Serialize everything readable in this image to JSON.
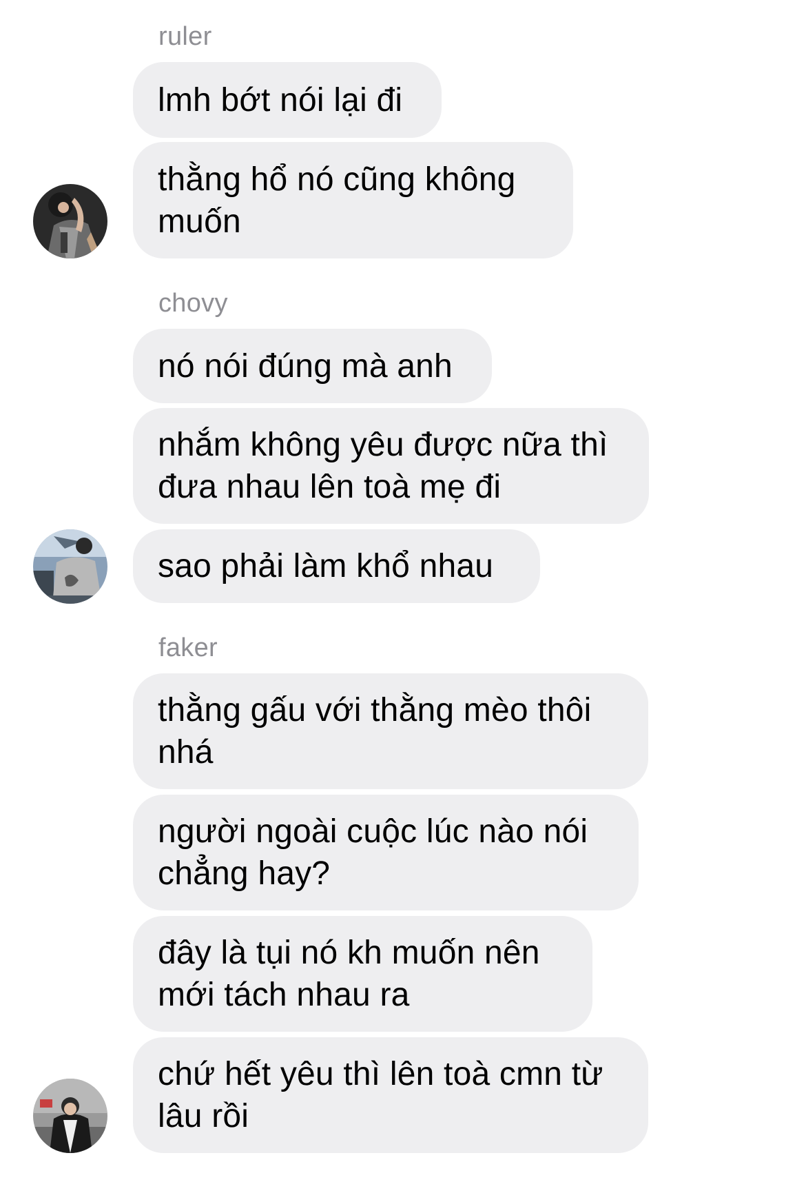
{
  "conversation": {
    "groups": [
      {
        "sender": "ruler",
        "avatar_icon": "profile-photo-avatar",
        "messages": [
          "lmh bớt nói lại đi",
          "thằng hổ nó cũng không\nmuốn"
        ]
      },
      {
        "sender": "chovy",
        "avatar_icon": "profile-photo-avatar",
        "messages": [
          "nó nói đúng mà anh",
          "nhắm không yêu được nữa thì\nđưa nhau lên toà mẹ đi",
          "sao phải làm khổ nhau"
        ]
      },
      {
        "sender": "faker",
        "avatar_icon": "profile-photo-avatar",
        "messages": [
          "thằng gấu với thằng mèo thôi\nnhá",
          "người ngoài cuộc lúc nào nói\nchẳng hay?",
          "đây là tụi nó kh muốn nên\nmới tách nhau ra",
          "chứ hết yêu thì lên toà cmn từ\nlâu rồi"
        ]
      }
    ]
  },
  "colors": {
    "bubble_background": "#eeeef0",
    "sender_name": "#8e8e93",
    "message_text": "#000000",
    "page_background": "#ffffff"
  }
}
